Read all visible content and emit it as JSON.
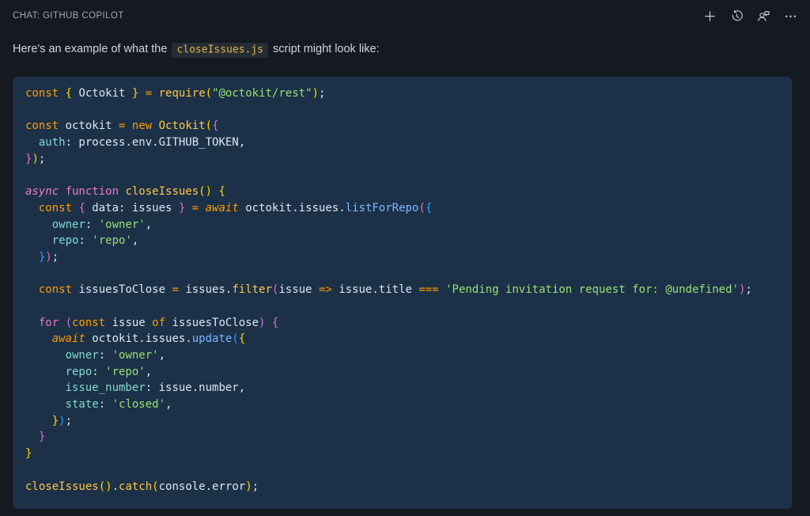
{
  "header": {
    "title": "CHAT: GITHUB COPILOT",
    "actions": [
      {
        "name": "new-chat",
        "icon": "plus-icon"
      },
      {
        "name": "show-history",
        "icon": "history-icon"
      },
      {
        "name": "account-feedback",
        "icon": "account-icon"
      },
      {
        "name": "more-actions",
        "icon": "ellipsis-icon"
      }
    ]
  },
  "message": {
    "text_before": "Here's an example of what the ",
    "inline_code": "closeIssues.js",
    "text_after": " script might look like:"
  },
  "colors": {
    "page_bg": "#151a20",
    "code_bg": "#1c3048",
    "chip_bg": "#262c34",
    "chip_fg": "#e2b64b",
    "title_fg": "#a2a8ad",
    "msg_fg": "#d2d6da",
    "icon_fg": "#c9cdd1",
    "tok": {
      "t": "#dbe7f3",
      "kw": "#ff9d00",
      "kwi": "#ff9d00",
      "kw2": "#ea7cc9",
      "it": "#ea7cc9",
      "fn": "#ffc845",
      "m": "#7cb8ff",
      "p": "#7fdbd4",
      "s": "#95e372",
      "b1": "#ffd700",
      "b2": "#da70d6",
      "b3": "#2da2ff"
    }
  },
  "code_block": {
    "language": "javascript",
    "lines": [
      [
        [
          "kw",
          "const "
        ],
        [
          "b1",
          "{"
        ],
        [
          "t",
          " Octokit "
        ],
        [
          "b1",
          "}"
        ],
        [
          "t",
          " "
        ],
        [
          "kw",
          "="
        ],
        [
          "t",
          " "
        ],
        [
          "fn",
          "require"
        ],
        [
          "b1",
          "("
        ],
        [
          "s",
          "\"@octokit/rest\""
        ],
        [
          "b1",
          ")"
        ],
        [
          "t",
          ";"
        ]
      ],
      [],
      [
        [
          "kw",
          "const "
        ],
        [
          "t",
          "octokit "
        ],
        [
          "kw",
          "="
        ],
        [
          "t",
          " "
        ],
        [
          "kw",
          "new "
        ],
        [
          "fn",
          "Octokit"
        ],
        [
          "b1",
          "("
        ],
        [
          "b2",
          "{"
        ]
      ],
      [
        [
          "t",
          "  "
        ],
        [
          "p",
          "auth"
        ],
        [
          "t",
          ": process.env.GITHUB_TOKEN,"
        ]
      ],
      [
        [
          "b2",
          "}"
        ],
        [
          "b1",
          ")"
        ],
        [
          "t",
          ";"
        ]
      ],
      [],
      [
        [
          "it",
          "async "
        ],
        [
          "kw2",
          "function "
        ],
        [
          "fn",
          "closeIssues"
        ],
        [
          "b1",
          "()"
        ],
        [
          "t",
          " "
        ],
        [
          "b1",
          "{"
        ]
      ],
      [
        [
          "t",
          "  "
        ],
        [
          "kw",
          "const "
        ],
        [
          "b2",
          "{"
        ],
        [
          "t",
          " data: issues "
        ],
        [
          "b2",
          "}"
        ],
        [
          "t",
          " "
        ],
        [
          "kw",
          "="
        ],
        [
          "t",
          " "
        ],
        [
          "kwi",
          "await "
        ],
        [
          "t",
          "octokit.issues."
        ],
        [
          "m",
          "listForRepo"
        ],
        [
          "b2",
          "("
        ],
        [
          "b3",
          "{"
        ]
      ],
      [
        [
          "t",
          "    "
        ],
        [
          "p",
          "owner"
        ],
        [
          "t",
          ": "
        ],
        [
          "s",
          "'owner'"
        ],
        [
          "t",
          ","
        ]
      ],
      [
        [
          "t",
          "    "
        ],
        [
          "p",
          "repo"
        ],
        [
          "t",
          ": "
        ],
        [
          "s",
          "'repo'"
        ],
        [
          "t",
          ","
        ]
      ],
      [
        [
          "t",
          "  "
        ],
        [
          "b3",
          "}"
        ],
        [
          "b2",
          ")"
        ],
        [
          "t",
          ";"
        ]
      ],
      [],
      [
        [
          "t",
          "  "
        ],
        [
          "kw",
          "const "
        ],
        [
          "t",
          "issuesToClose "
        ],
        [
          "kw",
          "="
        ],
        [
          "t",
          " issues."
        ],
        [
          "fn",
          "filter"
        ],
        [
          "b2",
          "("
        ],
        [
          "t",
          "issue "
        ],
        [
          "kw",
          "=>"
        ],
        [
          "t",
          " issue.title "
        ],
        [
          "kw",
          "==="
        ],
        [
          "t",
          " "
        ],
        [
          "s",
          "'Pending invitation request for: @undefined'"
        ],
        [
          "b2",
          ")"
        ],
        [
          "t",
          ";"
        ]
      ],
      [],
      [
        [
          "t",
          "  "
        ],
        [
          "kw2",
          "for "
        ],
        [
          "b2",
          "("
        ],
        [
          "kw",
          "const "
        ],
        [
          "t",
          "issue "
        ],
        [
          "kw",
          "of "
        ],
        [
          "t",
          "issuesToClose"
        ],
        [
          "b2",
          ")"
        ],
        [
          "t",
          " "
        ],
        [
          "b2",
          "{"
        ]
      ],
      [
        [
          "t",
          "    "
        ],
        [
          "kwi",
          "await "
        ],
        [
          "t",
          "octokit.issues."
        ],
        [
          "m",
          "update"
        ],
        [
          "b3",
          "("
        ],
        [
          "b1",
          "{"
        ]
      ],
      [
        [
          "t",
          "      "
        ],
        [
          "p",
          "owner"
        ],
        [
          "t",
          ": "
        ],
        [
          "s",
          "'owner'"
        ],
        [
          "t",
          ","
        ]
      ],
      [
        [
          "t",
          "      "
        ],
        [
          "p",
          "repo"
        ],
        [
          "t",
          ": "
        ],
        [
          "s",
          "'repo'"
        ],
        [
          "t",
          ","
        ]
      ],
      [
        [
          "t",
          "      "
        ],
        [
          "p",
          "issue_number"
        ],
        [
          "t",
          ": issue.number,"
        ]
      ],
      [
        [
          "t",
          "      "
        ],
        [
          "p",
          "state"
        ],
        [
          "t",
          ": "
        ],
        [
          "s",
          "'closed'"
        ],
        [
          "t",
          ","
        ]
      ],
      [
        [
          "t",
          "    "
        ],
        [
          "b1",
          "}"
        ],
        [
          "b3",
          ")"
        ],
        [
          "t",
          ";"
        ]
      ],
      [
        [
          "t",
          "  "
        ],
        [
          "b2",
          "}"
        ]
      ],
      [
        [
          "b1",
          "}"
        ]
      ],
      [],
      [
        [
          "fn",
          "closeIssues"
        ],
        [
          "b1",
          "()"
        ],
        [
          "t",
          "."
        ],
        [
          "fn",
          "catch"
        ],
        [
          "b1",
          "("
        ],
        [
          "t",
          "console.error"
        ],
        [
          "b1",
          ")"
        ],
        [
          "t",
          ";"
        ]
      ]
    ]
  }
}
